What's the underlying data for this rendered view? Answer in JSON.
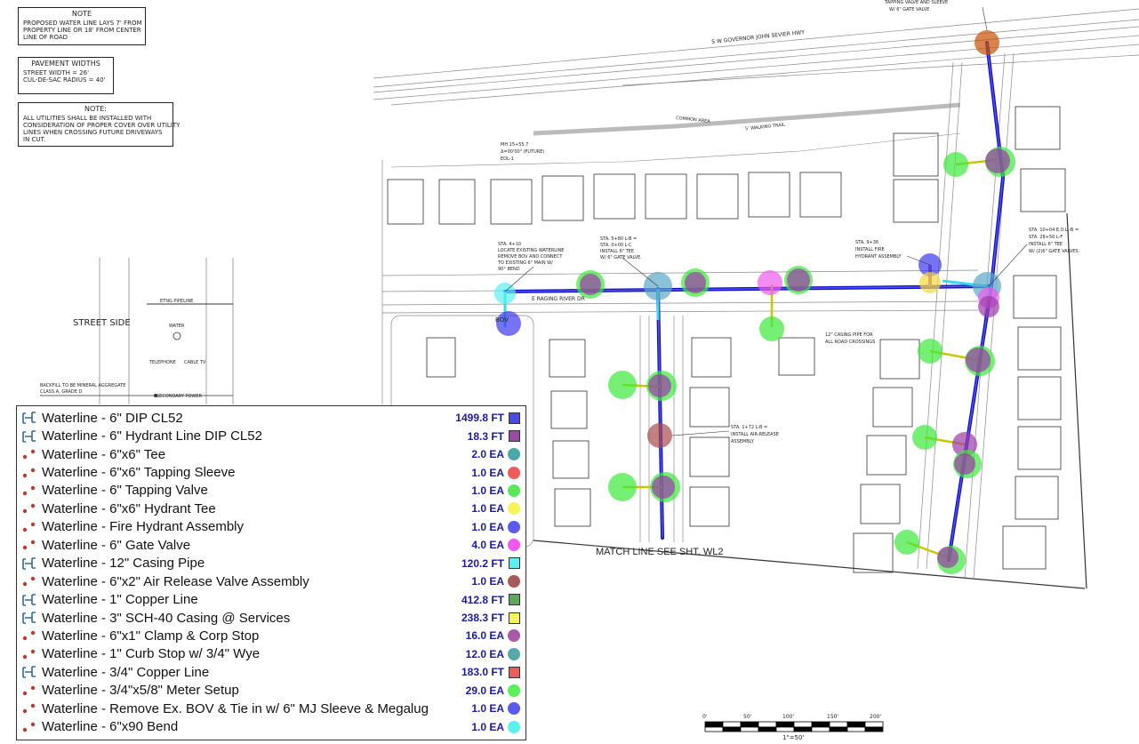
{
  "notes": {
    "water_title": "NOTE",
    "water_lines": [
      "PROPOSED WATER LINE LAYS 7' FROM",
      "PROPERTY LINE OR 18' FROM CENTER",
      "LINE OF ROAD"
    ],
    "pavement_title": "PAVEMENT WIDTHS",
    "pavement_lines": [
      "STREET WIDTH = 26'",
      "CUL-DE-SAC RADIUS = 40'"
    ],
    "utility_title": "NOTE:",
    "utility_lines": [
      "ALL UTILITIES SHALL BE INSTALLED WITH",
      "CONSIDERATION OF PROPER COVER OVER UTILITY",
      "LINES WHEN CROSSING FUTURE DRIVEWAYS",
      "IN CUT."
    ]
  },
  "section": {
    "street_side": "STREET SIDE",
    "etng_pipeline": "ETNG PIPELINE",
    "water": "WATER",
    "telephone": "TELEPHONE",
    "cable_tv": "CABLE TV",
    "secondary_power": "SECONDARY POWER",
    "backfill": [
      "BACKFILL TO BE MINERAL AGGREGATE",
      "CLASS A, GRADE D"
    ]
  },
  "plan": {
    "highway": "S W GOVERNOR JOHN SEVIER HWY",
    "street": "E RAGING RIVER DR",
    "match_line": "MATCH LINE SEE SHT. WL2",
    "tapping_note": [
      "TAPPING VALVE AND SLEEVE",
      "W/ 6\" GATE VALVE"
    ],
    "common_area": "COMMON AREA",
    "walking_trail": "5' WALKING TRAIL",
    "mh": [
      "MH 15+55.7",
      "Δ=00'00\" (FUTURE)",
      "EOL-1"
    ],
    "callout_bov": [
      "STA. 4+10",
      "LOCATE EXISTING WATERLINE",
      "REMOVE BOV AND CONNECT",
      "TO EXISTING 6\" MAIN W/",
      "90° BEND"
    ],
    "callout_tee": [
      "STA. 5+80 L-B =",
      "STA. 0+00 L-C",
      "INSTALL 6\" TEE",
      "W/ 6\" GATE VALVE."
    ],
    "callout_hydrant": [
      "STA. 9+36",
      "INSTALL FIRE",
      "HYDRANT ASSEMBLY"
    ],
    "callout_eol": [
      "STA. 10+04 E.O.L.-B =",
      "STA. 28+50 L-F",
      "INSTALL 6\" TEE",
      "W/ (2)6\" GATE VALVES."
    ],
    "callout_casing": [
      "12\" CASING PIPE FOR",
      "ALL ROAD CROSSINGS"
    ],
    "callout_air": [
      "STA. 1+72 L-B =",
      "INSTALL AIR-RELEASE",
      "ASSEMBLY"
    ],
    "bov_label": "BOV",
    "scale_ticks": [
      "0'",
      "50'",
      "100'",
      "150'",
      "200'"
    ],
    "scale_text": "1\"=50'"
  },
  "legend": [
    {
      "label": "Waterline - 6\" DIP CL52",
      "qty": "1499.8 FT",
      "icon": "line-icon",
      "color": "#4a4ae8",
      "swatch": "square"
    },
    {
      "label": "Waterline - 6\" Hydrant Line DIP CL52",
      "qty": "18.3 FT",
      "icon": "line-icon",
      "color": "#9b4aa8",
      "swatch": "square"
    },
    {
      "label": "Waterline - 6\"x6\" Tee",
      "qty": "2.0 EA",
      "icon": "count-icon",
      "color": "#4aa8a8",
      "swatch": "circle"
    },
    {
      "label": "Waterline - 6\"x6\" Tapping Sleeve",
      "qty": "1.0 EA",
      "icon": "count-icon",
      "color": "#f05a5a",
      "swatch": "circle"
    },
    {
      "label": "Waterline - 6\" Tapping Valve",
      "qty": "1.0 EA",
      "icon": "count-icon",
      "color": "#5ae85a",
      "swatch": "circle"
    },
    {
      "label": "Waterline - 6\"x6\" Hydrant Tee",
      "qty": "1.0 EA",
      "icon": "count-icon",
      "color": "#f5f55a",
      "swatch": "circle"
    },
    {
      "label": "Waterline - Fire Hydrant Assembly",
      "qty": "1.0 EA",
      "icon": "count-icon",
      "color": "#5a5af0",
      "swatch": "circle"
    },
    {
      "label": "Waterline - 6\" Gate Valve",
      "qty": "4.0 EA",
      "icon": "count-icon",
      "color": "#ee5aee",
      "swatch": "circle"
    },
    {
      "label": "Waterline - 12\" Casing Pipe",
      "qty": "120.2 FT",
      "icon": "line-icon",
      "color": "#5af0f0",
      "swatch": "square"
    },
    {
      "label": "Waterline - 6\"x2\" Air Release Valve Assembly",
      "qty": "1.0 EA",
      "icon": "count-icon",
      "color": "#a85a5a",
      "swatch": "circle"
    },
    {
      "label": "Waterline - 1\" Copper Line",
      "qty": "412.8 FT",
      "icon": "line-icon",
      "color": "#5aa85a",
      "swatch": "square"
    },
    {
      "label": "Waterline - 3\" SCH-40 Casing @ Services",
      "qty": "238.3 FT",
      "icon": "line-icon",
      "color": "#f5f55a",
      "swatch": "square"
    },
    {
      "label": "Waterline - 6\"x1\" Clamp & Corp Stop",
      "qty": "16.0 EA",
      "icon": "count-icon",
      "color": "#a85aa8",
      "swatch": "circle"
    },
    {
      "label": "Waterline - 1\" Curb Stop w/ 3/4\" Wye",
      "qty": "12.0 EA",
      "icon": "count-icon",
      "color": "#5aa8a8",
      "swatch": "circle"
    },
    {
      "label": "Waterline - 3/4\" Copper Line",
      "qty": "183.0 FT",
      "icon": "line-icon",
      "color": "#f05a5a",
      "swatch": "square"
    },
    {
      "label": "Waterline - 3/4\"x5/8\" Meter Setup",
      "qty": "29.0 EA",
      "icon": "count-icon",
      "color": "#5af05a",
      "swatch": "circle"
    },
    {
      "label": "Waterline - Remove Ex. BOV & Tie in w/ 6\" MJ Sleeve & Megalug",
      "qty": "1.0 EA",
      "icon": "count-icon",
      "color": "#5a5af0",
      "swatch": "circle"
    },
    {
      "label": "Waterline - 6\"x90 Bend",
      "qty": "1.0 EA",
      "icon": "count-icon",
      "color": "#5af0f0",
      "swatch": "circle"
    }
  ]
}
